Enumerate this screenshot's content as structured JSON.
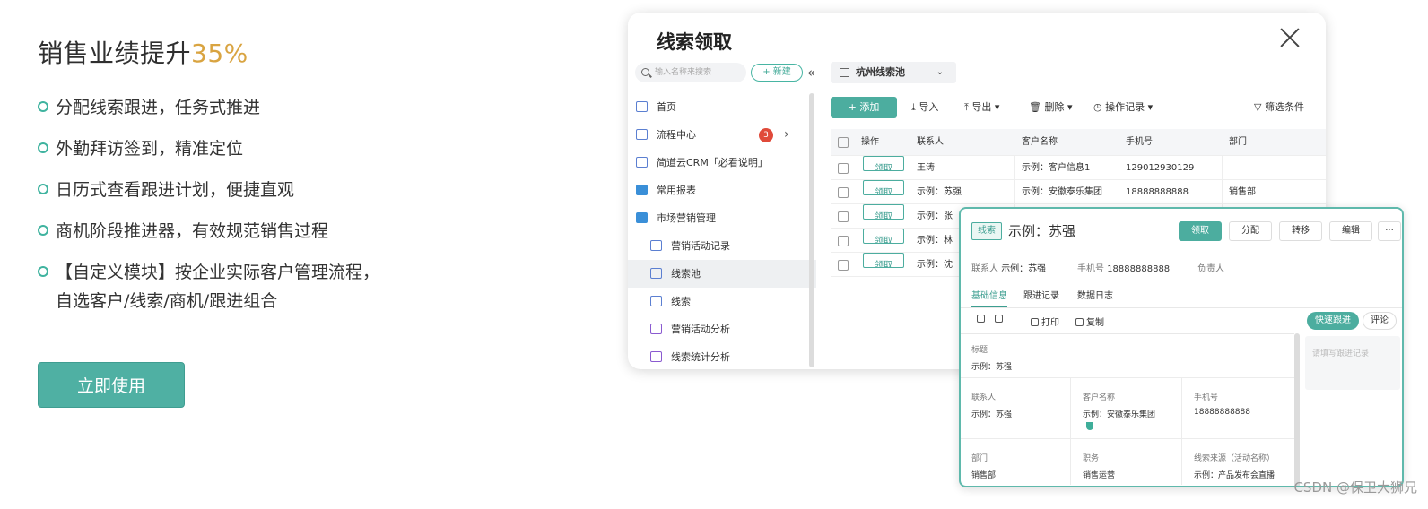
{
  "hero": {
    "headline_prefix": "销售业绩提升",
    "headline_accent": "35%",
    "features": [
      "分配线索跟进，任务式推进",
      "外勤拜访签到，精准定位",
      "日历式查看跟进计划，便捷直观",
      "商机阶段推进器，有效规范销售过程",
      "【自定义模块】按企业实际客户管理流程，",
      "自选客户/线索/商机/跟进组合"
    ],
    "cta_label": "立即使用",
    "accent_color": "#d9a441",
    "brand_color": "#4fb0a3"
  },
  "dialog": {
    "title": "线索领取",
    "search_placeholder": "输入名称来搜索",
    "new_label": "+ 新建",
    "collapse_glyph": "«",
    "nav": [
      {
        "label": "首页"
      },
      {
        "label": "流程中心",
        "badge": "3",
        "chevron": "›"
      },
      {
        "label": "简道云CRM「必看说明」"
      },
      {
        "label": "常用报表"
      },
      {
        "label": "市场营销管理"
      },
      {
        "label": "营销活动记录"
      },
      {
        "label": "线索池"
      },
      {
        "label": "线索"
      },
      {
        "label": "营销活动分析"
      },
      {
        "label": "线索统计分析"
      }
    ],
    "pool_tab": "杭州线索池",
    "pool_tab_chevron": "⌄",
    "toolbar": {
      "add": "+ 添加",
      "import": "⤓ 导入",
      "export": "⤒ 导出 ▾",
      "delete": "🗑 删除 ▾",
      "log": "◷ 操作记录 ▾",
      "filter": "▽ 筛选条件"
    },
    "table": {
      "headers": [
        "操作",
        "联系人",
        "客户名称",
        "手机号",
        "部门"
      ],
      "claim_label": "领取",
      "rows": [
        [
          "王涛",
          "示例：客户信息1",
          "129012930129",
          ""
        ],
        [
          "示例：苏强",
          "示例：安徽泰乐集团",
          "18888888888",
          "销售部"
        ],
        [
          "示例：张",
          "",
          "",
          ""
        ],
        [
          "示例：林",
          "",
          "",
          ""
        ],
        [
          "示例：沈",
          "",
          "",
          ""
        ]
      ]
    }
  },
  "card": {
    "tag": "线索",
    "title": "示例：苏强",
    "buttons": {
      "claim": "领取",
      "assign": "分配",
      "transfer": "转移",
      "edit": "编辑",
      "more": "···"
    },
    "meta": {
      "contact_key": "联系人",
      "contact_val": "示例：苏强",
      "phone_key": "手机号",
      "phone_val": "18888888888",
      "owner_key": "负责人"
    },
    "tabs": [
      "基础信息",
      "跟进记录",
      "数据日志"
    ],
    "tools": {
      "print": "打印",
      "copy": "复制"
    },
    "quick": "快速跟进",
    "comment": "评论",
    "followup_placeholder": "请填写跟进记录",
    "fields": {
      "title_k": "标题",
      "title_v": "示例：苏强",
      "contact_k": "联系人",
      "contact_v": "示例：苏强",
      "customer_k": "客户名称",
      "customer_v": "示例：安徽泰乐集团",
      "phone_k": "手机号",
      "phone_v": "18888888888",
      "dept_k": "部门",
      "dept_v": "销售部",
      "role_k": "职务",
      "role_v": "销售运营",
      "source_k": "线索来源（活动名称）",
      "source_v": "示例：产品发布会直播"
    }
  },
  "watermark": "CSDN @保卫大狮兄"
}
